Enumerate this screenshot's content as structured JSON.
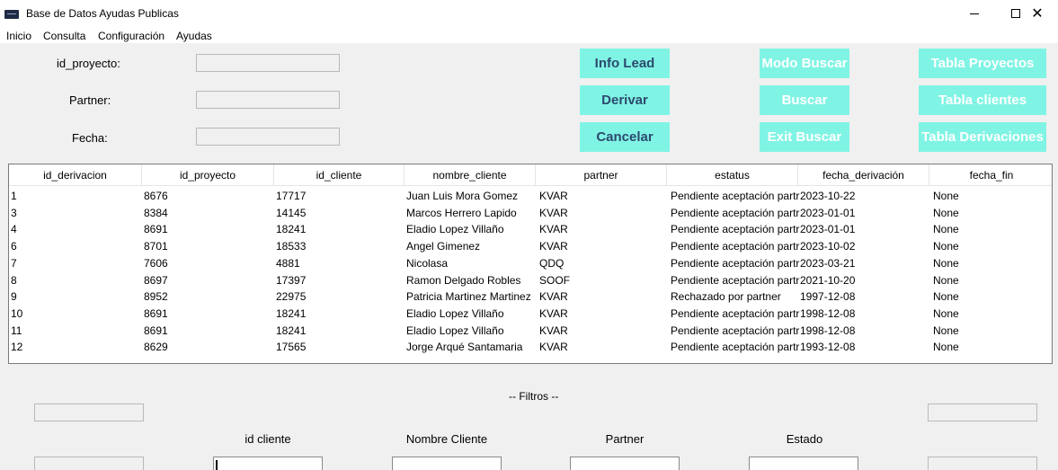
{
  "window": {
    "title": "Base de Datos Ayudas Publicas",
    "minimize_symbol": "—",
    "maximize_symbol": "☐",
    "close_symbol": "✕"
  },
  "menu": [
    "Inicio",
    "Consulta",
    "Configuración",
    "Ayudas"
  ],
  "form": {
    "id_proyecto_label": "id_proyecto:",
    "partner_label": "Partner:",
    "fecha_label": "Fecha:",
    "id_proyecto_value": "",
    "partner_value": "",
    "fecha_value": ""
  },
  "buttons": {
    "info_lead": "Info Lead",
    "derivar": "Derivar",
    "cancelar": "Cancelar",
    "modo_buscar": "Modo Buscar",
    "buscar": "Buscar",
    "exit_buscar": "Exit Buscar",
    "tabla_proyectos": "Tabla Proyectos",
    "tabla_clientes": "Tabla clientes",
    "tabla_derivaciones": "Tabla Derivaciones"
  },
  "colors": {
    "button_bg": "#80f4e4",
    "active_text": "#2c4a6e",
    "disabled_text": "#ffffff"
  },
  "table": {
    "columns": [
      "id_derivacion",
      "id_proyecto",
      "id_cliente",
      "nombre_cliente",
      "partner",
      "estatus",
      "fecha_derivación",
      "fecha_fin"
    ],
    "rows": [
      [
        "1",
        "8676",
        "17717",
        "Juan Luis Mora Gomez",
        "KVAR",
        "Pendiente aceptación partr",
        "2023-10-22",
        "None"
      ],
      [
        "3",
        "8384",
        "14145",
        "Marcos Herrero Lapido",
        "KVAR",
        "Pendiente aceptación partr",
        "2023-01-01",
        "None"
      ],
      [
        "4",
        "8691",
        "18241",
        "Eladio Lopez Villaño",
        "KVAR",
        "Pendiente aceptación partr",
        "2023-01-01",
        "None"
      ],
      [
        "6",
        "8701",
        "18533",
        "Angel Gimenez",
        "KVAR",
        "Pendiente aceptación partr",
        "2023-10-02",
        "None"
      ],
      [
        "7",
        "7606",
        "4881",
        "Nicolasa",
        "QDQ",
        "Pendiente aceptación partr",
        "2023-03-21",
        "None"
      ],
      [
        "8",
        "8697",
        "17397",
        "Ramon Delgado Robles",
        "SOOF",
        "Pendiente aceptación partr",
        "2021-10-20",
        "None"
      ],
      [
        "9",
        "8952",
        "22975",
        "Patricia Martinez Martinez",
        "KVAR",
        "Rechazado por partner",
        "1997-12-08",
        "None"
      ],
      [
        "10",
        "8691",
        "18241",
        "Eladio Lopez Villaño",
        "KVAR",
        "Pendiente aceptación partr",
        "1998-12-08",
        "None"
      ],
      [
        "11",
        "8691",
        "18241",
        "Eladio Lopez Villaño",
        "KVAR",
        "Pendiente aceptación partr",
        "1998-12-08",
        "None"
      ],
      [
        "12",
        "8629",
        "17565",
        "Jorge Arqué Santamaria",
        "KVAR",
        "Pendiente aceptación partr",
        "1993-12-08",
        "None"
      ]
    ]
  },
  "filters": {
    "title": "-- Filtros --",
    "id_cliente_label": "id cliente",
    "nombre_cliente_label": "Nombre Cliente",
    "partner_label": "Partner",
    "estado_label": "Estado",
    "id_cliente_value": "",
    "nombre_cliente_value": "",
    "partner_value": "",
    "estado_value": ""
  }
}
